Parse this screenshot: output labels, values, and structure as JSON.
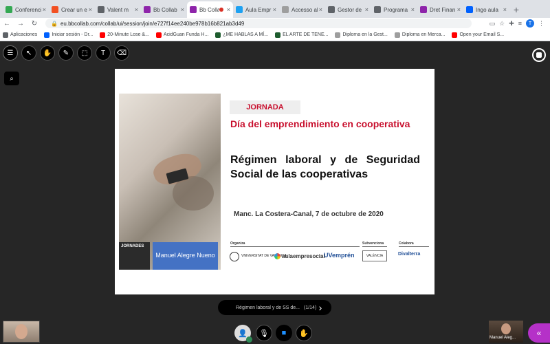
{
  "browser": {
    "tabs": [
      {
        "label": "Conferencia",
        "color": "#34a853"
      },
      {
        "label": "Crear un e",
        "color": "#f25022"
      },
      {
        "label": "Valent m",
        "color": "#5f6368"
      },
      {
        "label": "Bb Collab",
        "color": "#8e24aa"
      },
      {
        "label": "Bb Colla",
        "color": "#8e24aa",
        "active": true
      },
      {
        "label": "Aula Empr",
        "color": "#1da1f2"
      },
      {
        "label": "Accesso al",
        "color": "#9e9e9e"
      },
      {
        "label": "Gestor de",
        "color": "#5f6368"
      },
      {
        "label": "Programa",
        "color": "#5f6368"
      },
      {
        "label": "Dret Finan",
        "color": "#8e24aa"
      },
      {
        "label": "Ingo aula",
        "color": "#0061fe"
      }
    ],
    "url": "eu.bbcollab.com/collab/ui/session/join/e727f14ee240be978b16b821ab3d49",
    "avatar_letter": "T",
    "bookmarks": [
      {
        "label": "Aplicaciones",
        "color": "#5f6368"
      },
      {
        "label": "Iniciar sesión - Dr...",
        "color": "#0061fe"
      },
      {
        "label": "20-Minute Lose &...",
        "color": "#ff0000"
      },
      {
        "label": "AcidGuan Funda H...",
        "color": "#ff0000"
      },
      {
        "label": "¿ME HABLAS A MÍ...",
        "color": "#1e5c2e"
      },
      {
        "label": "EL ARTE DE TENE...",
        "color": "#1e5c2e"
      },
      {
        "label": "Diploma en la Gest...",
        "color": "#9e9e9e"
      },
      {
        "label": "Diploma en Merca...",
        "color": "#9e9e9e"
      },
      {
        "label": "Open your Email S...",
        "color": "#ff0000"
      }
    ]
  },
  "slide": {
    "tag": "JORNADA",
    "title_red": "Día del emprendimiento en cooperativa",
    "title_black": "Régimen laboral y de Seguridad Social de las cooperativas",
    "place_date": "Manc. La Costera-Canal, 7 de octubre de 2020",
    "presenter": "Manuel Alegre Nueno",
    "jornades": "JORNADES",
    "labels": {
      "organiza": "Organiza",
      "subvenciona": "Subvenciona",
      "colabora": "Colabora"
    },
    "logos": {
      "uv": "VNIVERSITAT DE VALÈNCIA",
      "aula": "aulaempresocial",
      "uvempren": "UVemprén",
      "valencia": "VALÈNCIA",
      "divalterra": "Divalterra"
    }
  },
  "presentation": {
    "file_label": "Régimen laboral y de SS de...",
    "page": "(1/14)"
  },
  "remote_user": "Manuel Aleg..."
}
